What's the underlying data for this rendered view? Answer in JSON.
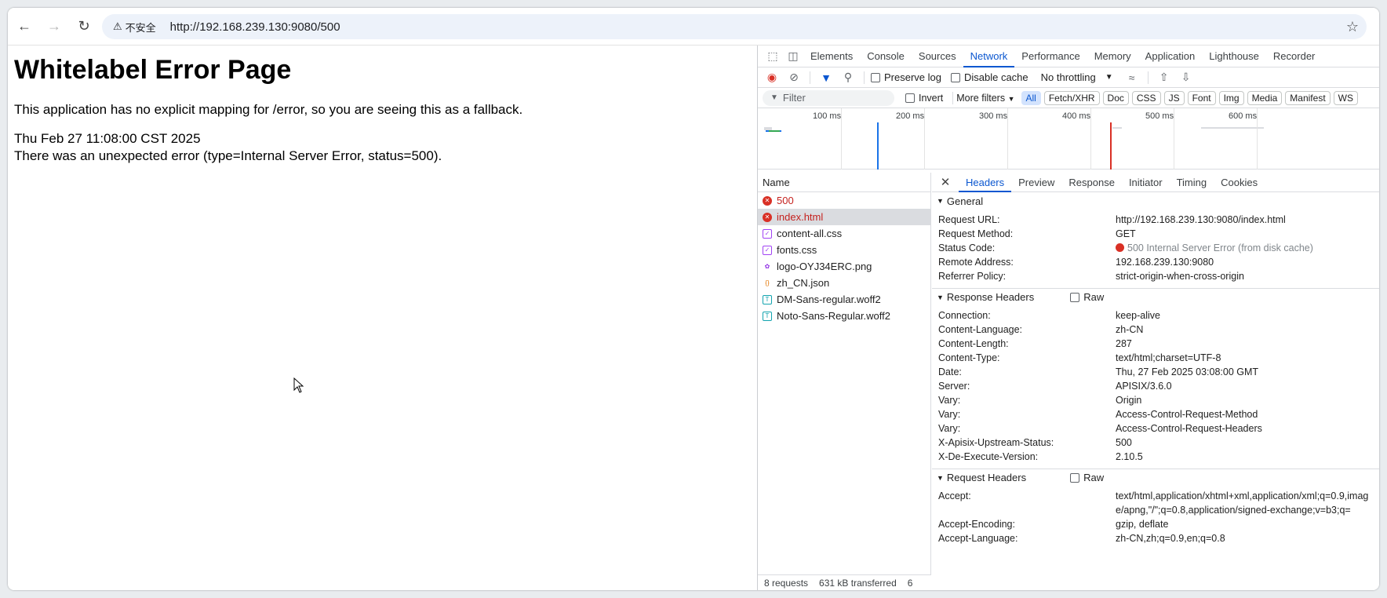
{
  "browser": {
    "security_label": "不安全",
    "url": "http://192.168.239.130:9080/500"
  },
  "page": {
    "title": "Whitelabel Error Page",
    "message": "This application has no explicit mapping for /error, so you are seeing this as a fallback.",
    "timestamp": "Thu Feb 27 11:08:00 CST 2025",
    "error": "There was an unexpected error (type=Internal Server Error, status=500)."
  },
  "devtools": {
    "tabs": [
      "Elements",
      "Console",
      "Sources",
      "Network",
      "Performance",
      "Memory",
      "Application",
      "Lighthouse",
      "Recorder"
    ],
    "active_tab": "Network",
    "toolbar": {
      "preserve_log": "Preserve log",
      "disable_cache": "Disable cache",
      "throttling": "No throttling"
    },
    "filter": {
      "placeholder": "Filter",
      "invert": "Invert",
      "more_filters": "More filters",
      "chips": [
        "All",
        "Fetch/XHR",
        "Doc",
        "CSS",
        "JS",
        "Font",
        "Img",
        "Media",
        "Manifest",
        "WS"
      ]
    },
    "timeline_labels": [
      "100 ms",
      "200 ms",
      "300 ms",
      "400 ms",
      "500 ms",
      "600 ms"
    ],
    "requests_header": "Name",
    "requests": [
      {
        "name": "500",
        "type": "err"
      },
      {
        "name": "index.html",
        "type": "err"
      },
      {
        "name": "content-all.css",
        "type": "css"
      },
      {
        "name": "fonts.css",
        "type": "css"
      },
      {
        "name": "logo-OYJ34ERC.png",
        "type": "img"
      },
      {
        "name": "zh_CN.json",
        "type": "json"
      },
      {
        "name": "DM-Sans-regular.woff2",
        "type": "font"
      },
      {
        "name": "Noto-Sans-Regular.woff2",
        "type": "font"
      }
    ],
    "status_bar": {
      "requests": "8 requests",
      "transferred": "631 kB transferred",
      "extra": "6"
    },
    "detail_tabs": [
      "Headers",
      "Preview",
      "Response",
      "Initiator",
      "Timing",
      "Cookies"
    ],
    "general": {
      "title": "General",
      "rows": [
        {
          "k": "Request URL:",
          "v": "http://192.168.239.130:9080/index.html"
        },
        {
          "k": "Request Method:",
          "v": "GET"
        },
        {
          "k": "Status Code:",
          "v": "500 Internal Server Error (from disk cache)"
        },
        {
          "k": "Remote Address:",
          "v": "192.168.239.130:9080"
        },
        {
          "k": "Referrer Policy:",
          "v": "strict-origin-when-cross-origin"
        }
      ]
    },
    "response_headers": {
      "title": "Response Headers",
      "raw": "Raw",
      "rows": [
        {
          "k": "Connection:",
          "v": "keep-alive"
        },
        {
          "k": "Content-Language:",
          "v": "zh-CN"
        },
        {
          "k": "Content-Length:",
          "v": "287"
        },
        {
          "k": "Content-Type:",
          "v": "text/html;charset=UTF-8"
        },
        {
          "k": "Date:",
          "v": "Thu, 27 Feb 2025 03:08:00 GMT"
        },
        {
          "k": "Server:",
          "v": "APISIX/3.6.0"
        },
        {
          "k": "Vary:",
          "v": "Origin"
        },
        {
          "k": "Vary:",
          "v": "Access-Control-Request-Method"
        },
        {
          "k": "Vary:",
          "v": "Access-Control-Request-Headers"
        },
        {
          "k": "X-Apisix-Upstream-Status:",
          "v": "500"
        },
        {
          "k": "X-De-Execute-Version:",
          "v": "2.10.5"
        }
      ]
    },
    "request_headers": {
      "title": "Request Headers",
      "raw": "Raw",
      "rows": [
        {
          "k": "Accept:",
          "v": "text/html,application/xhtml+xml,application/xml;q=0.9,image/apng,\"/\";q=0.8,application/signed-exchange;v=b3;q="
        },
        {
          "k": "Accept-Encoding:",
          "v": "gzip, deflate"
        },
        {
          "k": "Accept-Language:",
          "v": "zh-CN,zh;q=0.9,en;q=0.8"
        }
      ]
    }
  }
}
